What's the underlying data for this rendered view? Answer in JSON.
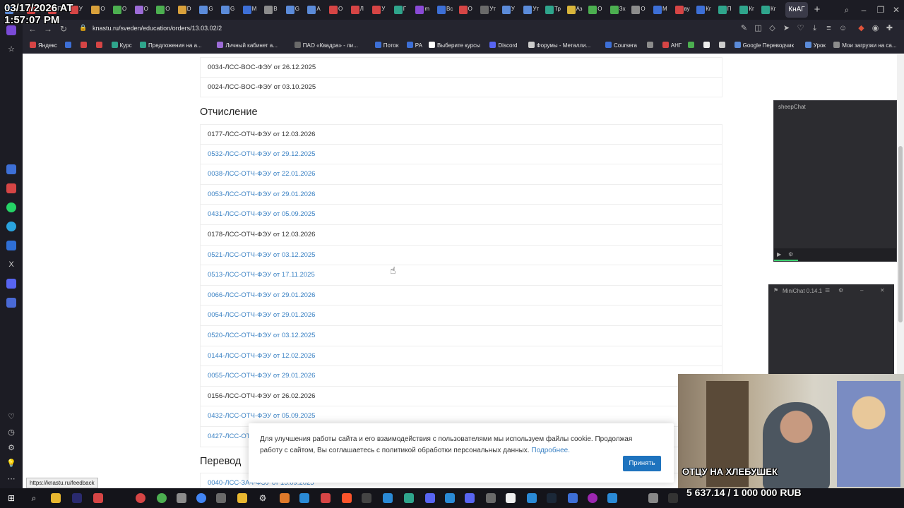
{
  "overlay": {
    "clock_line1": "03/17/2026 AT",
    "clock_line2": "1:57:07 PM"
  },
  "browser": {
    "tabs": [
      {
        "label": "П",
        "color": "#5b8bd9"
      },
      {
        "label": "П",
        "color": "#d64545"
      },
      {
        "label": "П",
        "color": "#d64545"
      },
      {
        "label": "У",
        "color": "#d64545"
      },
      {
        "label": "О",
        "color": "#d9a13b"
      },
      {
        "label": "О",
        "color": "#4caf50"
      },
      {
        "label": "О",
        "color": "#9c6bd6"
      },
      {
        "label": "О",
        "color": "#4caf50"
      },
      {
        "label": "D",
        "color": "#d9a13b"
      },
      {
        "label": "G",
        "color": "#5b8bd9"
      },
      {
        "label": "G",
        "color": "#5b8bd9"
      },
      {
        "label": "М",
        "color": "#3d6fd6"
      },
      {
        "label": "В",
        "color": "#8c8c8c"
      },
      {
        "label": "G",
        "color": "#5b8bd9"
      },
      {
        "label": "А",
        "color": "#5b8bd9"
      },
      {
        "label": "О",
        "color": "#d64545"
      },
      {
        "label": "Л",
        "color": "#d64545"
      },
      {
        "label": "У",
        "color": "#d64545"
      },
      {
        "label": "Г",
        "color": "#2fa58c"
      },
      {
        "label": "m",
        "color": "#8a4ad6"
      },
      {
        "label": "Вс",
        "color": "#3d6fd6"
      },
      {
        "label": "О",
        "color": "#d64545"
      },
      {
        "label": "Ут",
        "color": "#6a6a6a"
      },
      {
        "label": "У",
        "color": "#5b8bd9"
      },
      {
        "label": "Ут",
        "color": "#5b8bd9"
      },
      {
        "label": "Тр",
        "color": "#2fa58c"
      },
      {
        "label": "Аз",
        "color": "#d9b53b"
      },
      {
        "label": "О",
        "color": "#4caf50"
      },
      {
        "label": "Зх",
        "color": "#4caf50"
      },
      {
        "label": "О",
        "color": "#8c8c8c"
      },
      {
        "label": "М",
        "color": "#3d6fd6"
      },
      {
        "label": "ву",
        "color": "#d64545"
      },
      {
        "label": "Кг",
        "color": "#3d6fd6"
      },
      {
        "label": "П",
        "color": "#2fa58c"
      },
      {
        "label": "Кг",
        "color": "#2fa58c"
      },
      {
        "label": "Кг",
        "color": "#2fa58c"
      }
    ],
    "active_tab": "КнАГ",
    "url": "knastu.ru/sveden/education/orders/13.03.02/2",
    "new_tab_glyph": "+",
    "window_controls": [
      "–",
      "❐",
      "✕"
    ]
  },
  "bookmarks": [
    {
      "label": "Яндекс",
      "color": "#d64545"
    },
    {
      "label": "",
      "color": "#3d6fd6"
    },
    {
      "label": "",
      "color": "#d64545"
    },
    {
      "label": "",
      "color": "#d64545"
    },
    {
      "label": "Курс",
      "color": "#2fa58c"
    },
    {
      "label": "Предложения на а...",
      "color": "#2fa58c"
    },
    {
      "label": "Личный кабинет а...",
      "color": "#9c6bd6"
    },
    {
      "label": "ПАО «Квадра» - ли...",
      "color": "#6a6a6a"
    },
    {
      "label": "Поток",
      "color": "#3d6fd6"
    },
    {
      "label": "РА",
      "color": "#3d6fd6"
    },
    {
      "label": "Выберите курсы",
      "color": "#ffffff"
    },
    {
      "label": "Discord",
      "color": "#5865f2"
    },
    {
      "label": "Форумы - Металли...",
      "color": "#cccccc"
    },
    {
      "label": "Coursera",
      "color": "#3d6fd6"
    },
    {
      "label": "",
      "color": "#8c8c8c"
    },
    {
      "label": "АНГ",
      "color": "#d64545"
    },
    {
      "label": "",
      "color": "#4caf50"
    },
    {
      "label": "",
      "color": "#eeeeee"
    },
    {
      "label": "",
      "color": "#cccccc"
    },
    {
      "label": "Google Переводчик",
      "color": "#5b8bd9"
    },
    {
      "label": "Урок",
      "color": "#5b8bd9"
    },
    {
      "label": "Мои загрузки на са...",
      "color": "#8c8c8c"
    }
  ],
  "page": {
    "top_rows": [
      {
        "text": "0034-ЛСС-ВОС-ФЭУ от 26.12.2025",
        "link": false
      },
      {
        "text": "0024-ЛСС-ВОС-ФЭУ от 03.10.2025",
        "link": false
      }
    ],
    "section_expulsion": "Отчисление",
    "expulsion_rows": [
      {
        "text": "0177-ЛСС-ОТЧ-ФЭУ от 12.03.2026",
        "link": false
      },
      {
        "text": "0532-ЛСС-ОТЧ-ФЭУ от 29.12.2025",
        "link": true
      },
      {
        "text": "0038-ЛСС-ОТЧ-ФЭУ от 22.01.2026",
        "link": true
      },
      {
        "text": "0053-ЛСС-ОТЧ-ФЭУ от 29.01.2026",
        "link": true
      },
      {
        "text": "0431-ЛСС-ОТЧ-ФЭУ от 05.09.2025",
        "link": true
      },
      {
        "text": "0178-ЛСС-ОТЧ-ФЭУ от 12.03.2026",
        "link": false
      },
      {
        "text": "0521-ЛСС-ОТЧ-ФЭУ от 03.12.2025",
        "link": true
      },
      {
        "text": "0513-ЛСС-ОТЧ-ФЭУ от 17.11.2025",
        "link": true
      },
      {
        "text": "0066-ЛСС-ОТЧ-ФЭУ от 29.01.2026",
        "link": true
      },
      {
        "text": "0054-ЛСС-ОТЧ-ФЭУ от 29.01.2026",
        "link": true
      },
      {
        "text": "0520-ЛСС-ОТЧ-ФЭУ от 03.12.2025",
        "link": true
      },
      {
        "text": "0144-ЛСС-ОТЧ-ФЭУ от 12.02.2026",
        "link": true
      },
      {
        "text": "0055-ЛСС-ОТЧ-ФЭУ от 29.01.2026",
        "link": true
      },
      {
        "text": "0156-ЛСС-ОТЧ-ФЭУ от 26.02.2026",
        "link": false
      },
      {
        "text": "0432-ЛСС-ОТЧ-ФЭУ от 05.09.2025",
        "link": true
      },
      {
        "text": "0427-ЛСС-ОТЧ",
        "link": true
      }
    ],
    "section_transfer": "Перевод",
    "transfer_rows": [
      {
        "text": "0040-ЛСС-ЗАЧ-ФЭУ от 15.09.2025",
        "link": true
      }
    ]
  },
  "cookie_banner": {
    "message": "Для улучшения работы сайта и его взаимодействия с пользователями мы используем файлы cookie. Продолжая работу с сайтом, Вы соглашаетесь с политикой обработки персональных данных.",
    "more_link": "Подробнее.",
    "accept_button": "Принять"
  },
  "status_tooltip": "https://knastu.ru/feedback",
  "sheepchat": {
    "title": "sheepChat"
  },
  "minichat": {
    "title": "MiniChat 0.14.1"
  },
  "stream_overlay": {
    "caption": "ОТЦУ НА ХЛЕБУШЕК",
    "goal": "5 637.14 / 1 000 000 RUB"
  },
  "colors": {
    "link": "#3b82c4",
    "accept_button": "#1e73be",
    "chrome_dark": "#1c1c24"
  }
}
